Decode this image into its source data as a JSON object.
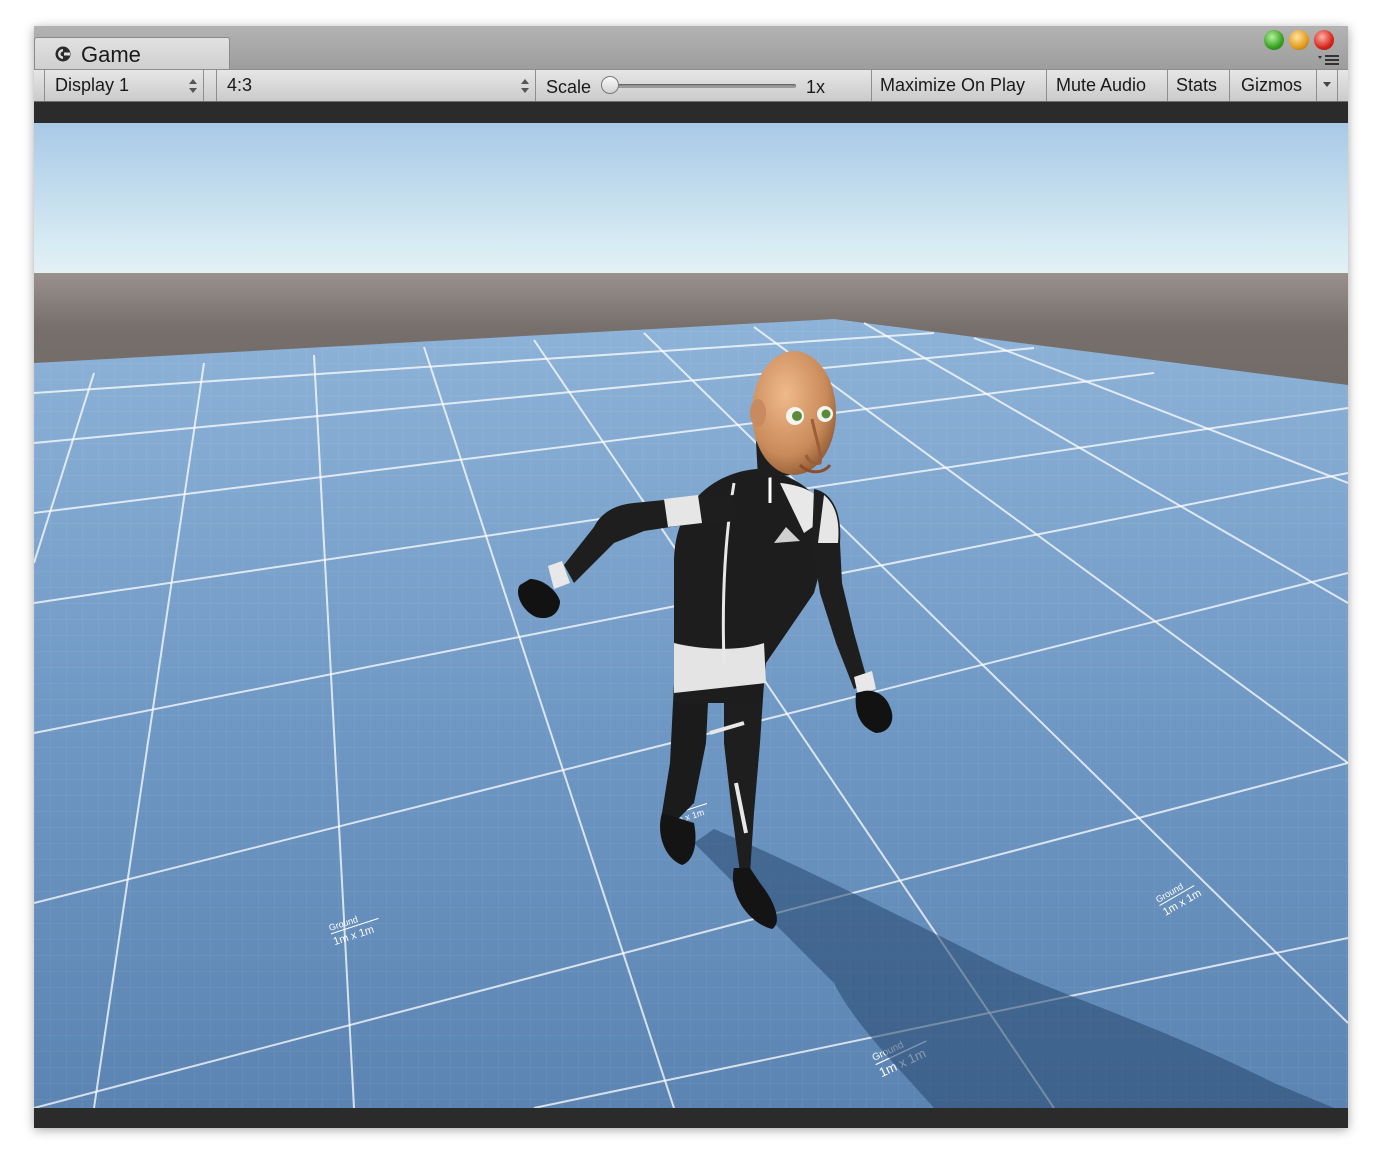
{
  "window": {
    "tab_label": "Game",
    "tab_icon": "unity-game-icon",
    "menu_icon": "panel-menu-icon"
  },
  "toolbar": {
    "display_select": "Display 1",
    "aspect_select": "4:3",
    "scale_label": "Scale",
    "scale_value": "1x",
    "scale_fraction": 0.0,
    "maximize_label": "Maximize On Play",
    "mute_label": "Mute Audio",
    "stats_label": "Stats",
    "gizmos_label": "Gizmos"
  },
  "scene": {
    "ground_label": "Ground",
    "ground_scale_label": "1m x 1m",
    "sky_color": "#aacbe6",
    "horizon_color": "#dfeff4",
    "wall_color": "#6f6866",
    "floor_color": "#6f98c4",
    "grid_color": "#ffffff"
  }
}
